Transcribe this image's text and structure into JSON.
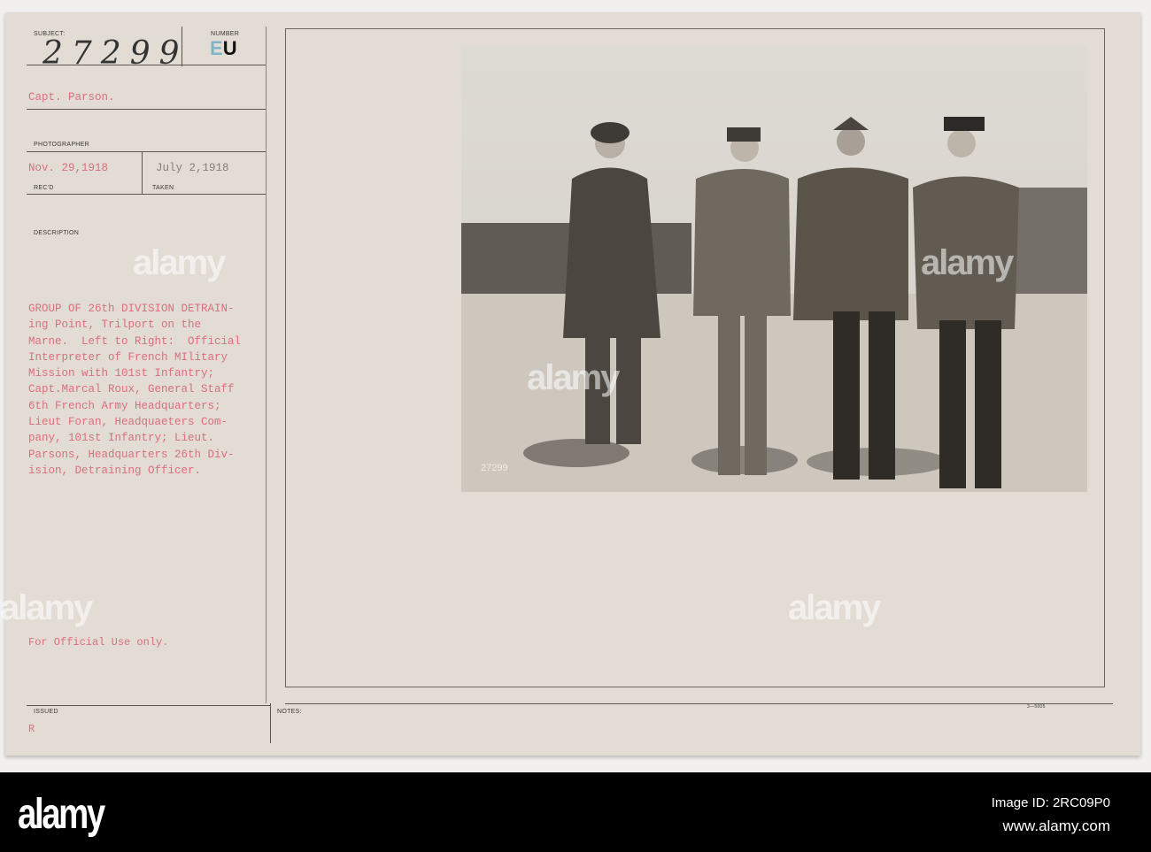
{
  "card": {
    "subject_label": "SUBJECT:",
    "subject_number": "27299",
    "number_label": "NUMBER",
    "number_code_prefix": "E",
    "number_code_suffix": "U",
    "photographer_name": "Capt. Parson.",
    "photographer_label": "PHOTOGRAPHER",
    "received_date": "Nov. 29,1918",
    "received_label": "REC'D",
    "taken_date": "July 2,1918",
    "taken_label": "TAKEN",
    "description_label": "DESCRIPTION",
    "description_lines": [
      "GROUP OF 26th DIVISION DETRAIN-",
      "ing Point, Trilport on the",
      "Marne.  Left to Right:  Official",
      "Interpreter of French MIlitary",
      "Mission with 101st Infantry;",
      "Capt.Marcal Roux, General Staff",
      "6th French Army Headquarters;",
      "Lieut Foran, Headquaeters Com-",
      "pany, 101st Infantry; Lieut.",
      "Parsons, Headquarters 26th Div-",
      "ision, Detraining Officer."
    ],
    "official_use": "For Official Use only.",
    "issued_label": "ISSUED",
    "issued_value": "R",
    "notes_label": "NOTES:",
    "form_number": "3—5005",
    "photo_stamp": "27299"
  },
  "watermark": "alamy",
  "footer": {
    "logo": "alamy",
    "image_id": "Image ID: 2RC09P0",
    "url": "www.alamy.com"
  }
}
